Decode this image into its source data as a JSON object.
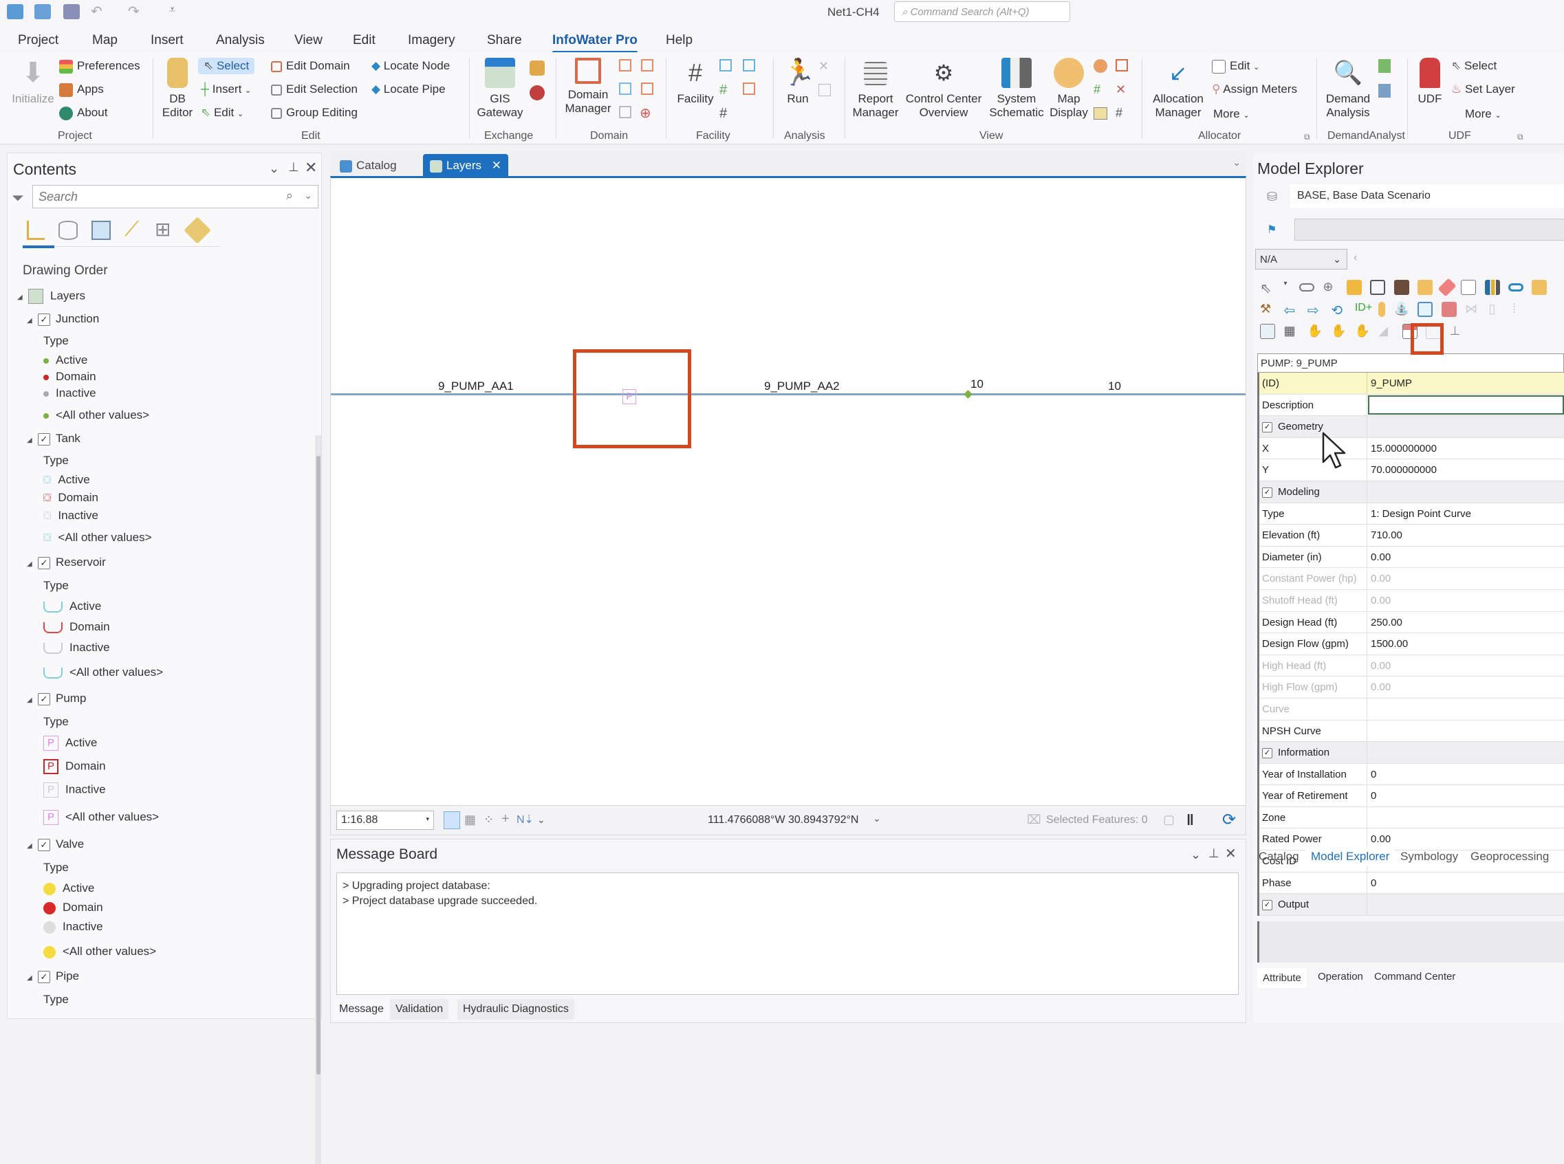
{
  "window": {
    "title": "Net1-CH4",
    "command_search_placeholder": "Command Search (Alt+Q)"
  },
  "quick_access": [
    "new-project-icon",
    "open-project-icon",
    "save-project-icon",
    "undo-icon",
    "redo-icon",
    "customize-icon"
  ],
  "menu": {
    "items": [
      "Project",
      "Map",
      "Insert",
      "Analysis",
      "View",
      "Edit",
      "Imagery",
      "Share",
      "InfoWater Pro",
      "Help"
    ],
    "active": "InfoWater Pro"
  },
  "ribbon": {
    "groups": [
      {
        "name": "Project",
        "items": [
          "Initialize",
          "Preferences",
          "Apps",
          "About"
        ]
      },
      {
        "name": "Edit",
        "items": [
          "DB Editor",
          "Select",
          "Insert",
          "Edit",
          "Edit Domain",
          "Edit Selection",
          "Group Editing",
          "Locate Node",
          "Locate Pipe"
        ]
      },
      {
        "name": "Exchange",
        "items": [
          "GIS Gateway"
        ]
      },
      {
        "name": "Domain",
        "items": [
          "Domain Manager"
        ]
      },
      {
        "name": "Facility",
        "items": [
          "Facility"
        ]
      },
      {
        "name": "Analysis",
        "items": [
          "Run"
        ]
      },
      {
        "name": "View",
        "items": [
          "Report Manager",
          "Control Center Overview",
          "System Schematic",
          "Map Display"
        ]
      },
      {
        "name": "Allocator",
        "items": [
          "Allocation Manager",
          "Edit",
          "Assign Meters",
          "More"
        ]
      },
      {
        "name": "DemandAnalyst",
        "items": [
          "Demand Analysis"
        ]
      },
      {
        "name": "UDF",
        "items": [
          "UDF",
          "Select",
          "Set Layer",
          "More"
        ]
      }
    ],
    "labels": {
      "initialize": "Initialize",
      "preferences": "Preferences",
      "apps": "Apps",
      "about": "About",
      "db_editor_1": "DB",
      "db_editor_2": "Editor",
      "select": "Select",
      "insert": "Insert",
      "edit": "Edit",
      "edit_domain": "Edit Domain",
      "edit_selection": "Edit Selection",
      "group_editing": "Group Editing",
      "locate_node": "Locate Node",
      "locate_pipe": "Locate Pipe",
      "gis_1": "GIS",
      "gis_2": "Gateway",
      "domain_1": "Domain",
      "domain_2": "Manager",
      "facility": "Facility",
      "run": "Run",
      "report_1": "Report",
      "report_2": "Manager",
      "cco_1": "Control Center",
      "cco_2": "Overview",
      "sys_1": "System",
      "sys_2": "Schematic",
      "mapd_1": "Map",
      "mapd_2": "Display",
      "alloc_1": "Allocation",
      "alloc_2": "Manager",
      "alloc_edit": "Edit",
      "assign_meters": "Assign Meters",
      "more": "More",
      "demand_1": "Demand",
      "demand_2": "Analysis",
      "udf": "UDF",
      "udf_select": "Select",
      "set_layer": "Set Layer",
      "g_project": "Project",
      "g_edit": "Edit",
      "g_exchange": "Exchange",
      "g_domain": "Domain",
      "g_facility": "Facility",
      "g_analysis": "Analysis",
      "g_view": "View",
      "g_allocator": "Allocator",
      "g_demand": "DemandAnalyst",
      "g_udf": "UDF"
    }
  },
  "contents": {
    "title": "Contents",
    "search_placeholder": "Search",
    "section": "Drawing Order",
    "root": "Layers",
    "type_label": "Type",
    "layers": [
      {
        "name": "Junction",
        "classes": [
          "Active",
          "Domain",
          "Inactive",
          "<All other values>"
        ]
      },
      {
        "name": "Tank",
        "classes": [
          "Active",
          "Domain",
          "Inactive",
          "<All other values>"
        ]
      },
      {
        "name": "Reservoir",
        "classes": [
          "Active",
          "Domain",
          "Inactive",
          "<All other values>"
        ]
      },
      {
        "name": "Pump",
        "classes": [
          "Active",
          "Domain",
          "Inactive",
          "<All other values>"
        ]
      },
      {
        "name": "Valve",
        "classes": [
          "Active",
          "Domain",
          "Inactive",
          "<All other values>"
        ]
      },
      {
        "name": "Pipe",
        "classes": []
      }
    ]
  },
  "doc_tabs": [
    {
      "label": "Catalog",
      "active": false
    },
    {
      "label": "Layers",
      "active": true
    }
  ],
  "map": {
    "labels": {
      "pipe_left": "9_PUMP_AA1",
      "pipe_right": "9_PUMP_AA2",
      "node_label": "10",
      "pipe_label": "10"
    },
    "pump_symbol": "P",
    "scale": "1:16.88",
    "coordinates": "111.4766088°W 30.8943792°N",
    "selected_features": "Selected Features: 0"
  },
  "message_board": {
    "title": "Message Board",
    "lines": [
      "> Upgrading project database:",
      "> Project database upgrade succeeded."
    ],
    "tabs": [
      "Message",
      "Validation",
      "Hydraulic Diagnostics"
    ],
    "active_tab": "Message"
  },
  "model_explorer": {
    "title": "Model Explorer",
    "scenario": "BASE, Base Data Scenario",
    "filter_value": "N/A",
    "object_header": "PUMP: 9_PUMP",
    "properties": [
      {
        "k": "(ID)",
        "v": "9_PUMP",
        "kind": "key"
      },
      {
        "k": "Description",
        "v": "",
        "kind": "desc"
      },
      {
        "k": "Geometry",
        "v": "",
        "kind": "cat"
      },
      {
        "k": "X",
        "v": "15.000000000",
        "kind": "norm"
      },
      {
        "k": "Y",
        "v": "70.000000000",
        "kind": "norm"
      },
      {
        "k": "Modeling",
        "v": "",
        "kind": "cat"
      },
      {
        "k": "Type",
        "v": "1: Design Point Curve",
        "kind": "norm"
      },
      {
        "k": "Elevation (ft)",
        "v": "710.00",
        "kind": "norm"
      },
      {
        "k": "Diameter (in)",
        "v": "0.00",
        "kind": "norm"
      },
      {
        "k": "Constant Power (hp)",
        "v": "0.00",
        "kind": "dis"
      },
      {
        "k": "Shutoff Head (ft)",
        "v": "0.00",
        "kind": "dis"
      },
      {
        "k": "Design Head (ft)",
        "v": "250.00",
        "kind": "norm"
      },
      {
        "k": "Design Flow (gpm)",
        "v": "1500.00",
        "kind": "norm"
      },
      {
        "k": "High Head (ft)",
        "v": "0.00",
        "kind": "dis"
      },
      {
        "k": "High Flow (gpm)",
        "v": "0.00",
        "kind": "dis"
      },
      {
        "k": "Curve",
        "v": "",
        "kind": "dis"
      },
      {
        "k": "NPSH Curve",
        "v": "",
        "kind": "norm"
      },
      {
        "k": "Information",
        "v": "",
        "kind": "cat"
      },
      {
        "k": "Year of Installation",
        "v": "0",
        "kind": "norm"
      },
      {
        "k": "Year of Retirement",
        "v": "0",
        "kind": "norm"
      },
      {
        "k": "Zone",
        "v": "",
        "kind": "norm"
      },
      {
        "k": "Rated Power",
        "v": "0.00",
        "kind": "norm"
      },
      {
        "k": "Cost ID",
        "v": "",
        "kind": "norm"
      },
      {
        "k": "Phase",
        "v": "0",
        "kind": "norm"
      },
      {
        "k": "Output",
        "v": "",
        "kind": "cat"
      }
    ],
    "sub_tabs": [
      "Attribute",
      "Operation",
      "Command Center"
    ],
    "active_sub_tab": "Attribute"
  },
  "bottom_tabs": [
    "Catalog",
    "Model Explorer",
    "Symbology",
    "Geoprocessing"
  ],
  "active_bottom_tab": "Model Explorer",
  "colors": {
    "accent": "#1d6fc0",
    "highlight_box": "#d4471f",
    "pump_active": "#e07ee0",
    "junction_active": "#7cb342"
  }
}
